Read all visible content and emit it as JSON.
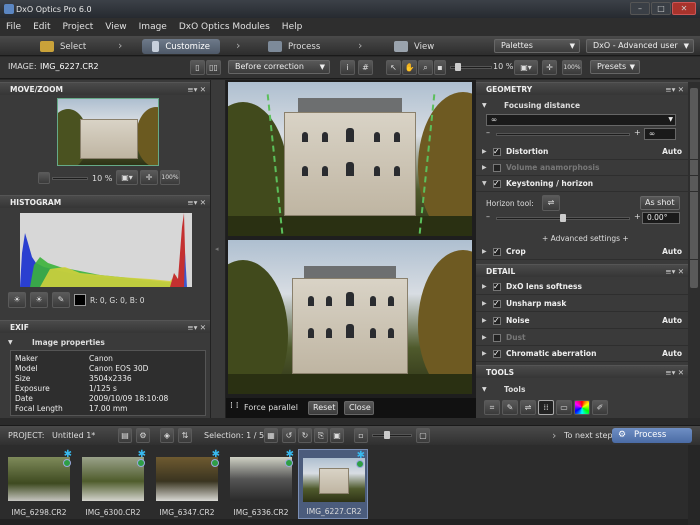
{
  "app": {
    "title": "DxO Optics Pro 6.0"
  },
  "window_controls": {
    "minimize": "–",
    "maximize": "□",
    "close": "✕"
  },
  "menu": [
    "File",
    "Edit",
    "Project",
    "View",
    "Image",
    "DxO Optics Modules",
    "Help"
  ],
  "workflow": {
    "steps": [
      "Select",
      "Customize",
      "Process",
      "View"
    ],
    "active": "Customize",
    "palettes": "Palettes",
    "user_mode": "DxO - Advanced user"
  },
  "imagebar": {
    "image_label": "IMAGE:",
    "image_name": "IMG_6227.CR2",
    "compare_mode": "Before correction",
    "zoom": "10 %",
    "zoom_100": "100%",
    "presets": "Presets"
  },
  "left": {
    "move_zoom": {
      "title": "MOVE/ZOOM",
      "zoom": "10 %",
      "zoom_100": "100%"
    },
    "histogram": {
      "title": "HISTOGRAM",
      "rgb_readout": "R:  0, G:  0, B:  0"
    },
    "exif": {
      "title": "EXIF",
      "section": "Image properties",
      "rows": [
        {
          "k": "Maker",
          "v": "Canon"
        },
        {
          "k": "Model",
          "v": "Canon EOS 30D"
        },
        {
          "k": "Size",
          "v": "3504x2336"
        },
        {
          "k": "Exposure",
          "v": "1/125 s"
        },
        {
          "k": "Date",
          "v": "2009/10/09 18:10:08"
        },
        {
          "k": "Focal Length",
          "v": "17.00 mm"
        }
      ]
    }
  },
  "center": {
    "force_parallel": "Force parallel",
    "reset": "Reset",
    "close": "Close"
  },
  "right": {
    "geometry": {
      "title": "GEOMETRY",
      "focusing": "Focusing distance",
      "focus_value": "∞",
      "focus_field": "∞",
      "items": [
        {
          "label": "Distortion",
          "status": "Auto",
          "checked": true,
          "dim": false
        },
        {
          "label": "Volume anamorphosis",
          "status": "",
          "checked": false,
          "dim": true
        },
        {
          "label": "Keystoning / horizon",
          "status": "",
          "checked": true,
          "dim": false
        }
      ],
      "horizon_tool": "Horizon tool:",
      "as_shot": "As shot",
      "angle": "0.00°",
      "advanced": "+ Advanced settings +",
      "crop": {
        "label": "Crop",
        "status": "Auto"
      }
    },
    "detail": {
      "title": "DETAIL",
      "items": [
        {
          "label": "DxO lens softness",
          "status": "",
          "dim": false
        },
        {
          "label": "Unsharp mask",
          "status": "",
          "dim": false
        },
        {
          "label": "Noise",
          "status": "Auto",
          "dim": false
        },
        {
          "label": "Dust",
          "status": "",
          "dim": true
        },
        {
          "label": "Chromatic aberration",
          "status": "Auto",
          "dim": false
        }
      ]
    },
    "tools": {
      "title": "TOOLS",
      "section": "Tools"
    }
  },
  "project": {
    "label": "PROJECT:",
    "name": "Untitled 1*",
    "selection": "Selection: 1 / 5",
    "next_step": "To next step",
    "process": "Process"
  },
  "filmstrip": [
    {
      "name": "IMG_6298.CR2",
      "selected": false
    },
    {
      "name": "IMG_6300.CR2",
      "selected": false
    },
    {
      "name": "IMG_6347.CR2",
      "selected": false
    },
    {
      "name": "IMG_6336.CR2",
      "selected": false
    },
    {
      "name": "IMG_6227.CR2",
      "selected": true
    }
  ],
  "colors": {
    "accent": "#5b86c2",
    "panel": "#3a3a3a",
    "star": "#38b9ef",
    "status_dot": "#2e9e45"
  }
}
